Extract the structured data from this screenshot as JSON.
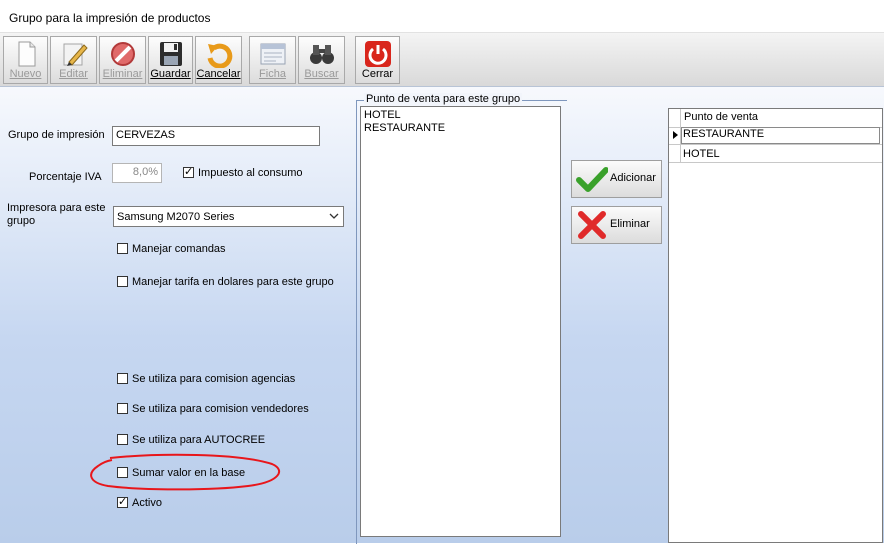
{
  "window": {
    "title": "Grupo para la impresión de productos"
  },
  "toolbar": {
    "buttons": [
      {
        "label": "Nuevo",
        "icon": "new-document-icon",
        "enabled": false
      },
      {
        "label": "Editar",
        "icon": "pencil-icon",
        "enabled": false
      },
      {
        "label": "Eliminar",
        "icon": "no-entry-icon",
        "enabled": false
      },
      {
        "label": "Guardar",
        "icon": "floppy-disk-icon",
        "enabled": true
      },
      {
        "label": "Cancelar",
        "icon": "undo-arrow-icon",
        "enabled": true
      },
      {
        "label": "Ficha",
        "icon": "record-card-icon",
        "enabled": false
      },
      {
        "label": "Buscar",
        "icon": "binoculars-icon",
        "enabled": false
      },
      {
        "label": "Cerrar",
        "icon": "power-icon",
        "enabled": true
      }
    ]
  },
  "form": {
    "grupo_label": "Grupo de impresión",
    "grupo_value": "CERVEZAS",
    "iva_label": "Porcentaje IVA",
    "iva_value": "8,0%",
    "impuesto_label": "Impuesto al consumo",
    "impuesto_checked": true,
    "impresora_label": "Impresora para este grupo",
    "impresora_value": "Samsung M2070 Series",
    "checkboxes": [
      {
        "label": "Manejar comandas",
        "checked": false
      },
      {
        "label": "Manejar tarifa en dolares para este grupo",
        "checked": false
      },
      {
        "label": "Se utiliza para comision agencias",
        "checked": false
      },
      {
        "label": "Se utiliza para comision vendedores",
        "checked": false
      },
      {
        "label": "Se utiliza para AUTOCREE",
        "checked": false
      },
      {
        "label": "Sumar valor en la base",
        "checked": false
      },
      {
        "label": "Activo",
        "checked": true
      }
    ]
  },
  "puntos": {
    "group_title": "Punto de venta para este grupo",
    "available": [
      "HOTEL",
      "RESTAURANTE"
    ],
    "add_label": "Adicionar",
    "remove_label": "Eliminar",
    "grid_header": "Punto de venta",
    "grid_rows": [
      "RESTAURANTE",
      "HOTEL"
    ]
  },
  "colors": {
    "annotation": "#e8161b",
    "content_bg": "#c6d7f1",
    "power_red": "#d9261c"
  }
}
